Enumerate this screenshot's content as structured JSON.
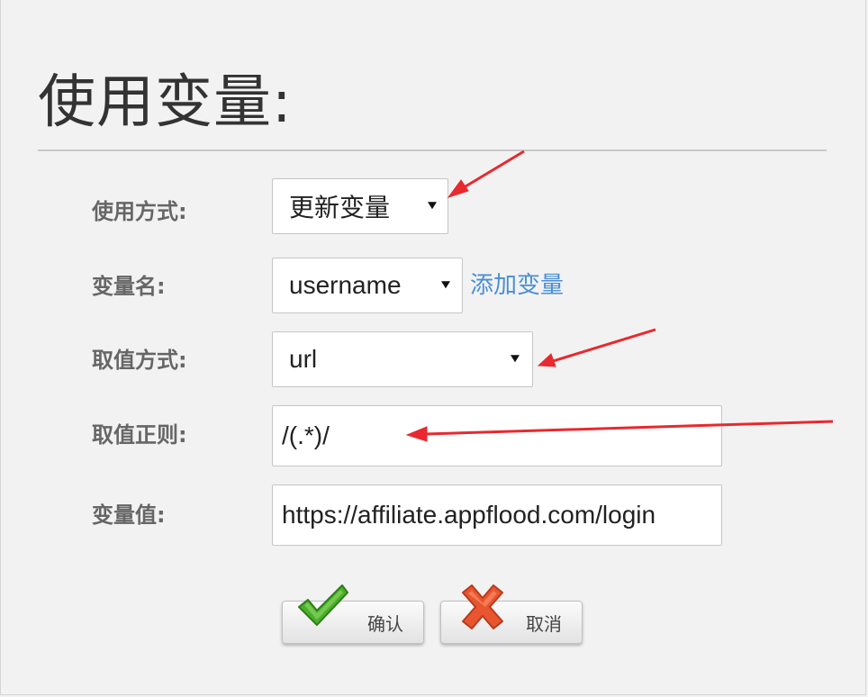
{
  "dialog": {
    "title": "使用变量:"
  },
  "form": {
    "usage": {
      "label": "使用方式:",
      "value": "更新变量"
    },
    "var_name": {
      "label": "变量名:",
      "value": "username",
      "add_link": "添加变量"
    },
    "source": {
      "label": "取值方式:",
      "value": "url"
    },
    "regex": {
      "label": "取值正则:",
      "value": "/(.*)/"
    },
    "var_value": {
      "label": "变量值:",
      "value": "https://affiliate.appflood.com/login"
    }
  },
  "buttons": {
    "confirm_label": "确认",
    "cancel_label": "取消"
  },
  "colors": {
    "background": "#f2f2f2",
    "link": "#4a8fd6",
    "annotation_arrow": "#e8292f",
    "confirm_icon": "#4caf2a",
    "cancel_icon": "#e8552f"
  },
  "icons": {
    "confirm": "checkmark-icon",
    "cancel": "x-icon",
    "dropdown": "caret-down-icon"
  }
}
